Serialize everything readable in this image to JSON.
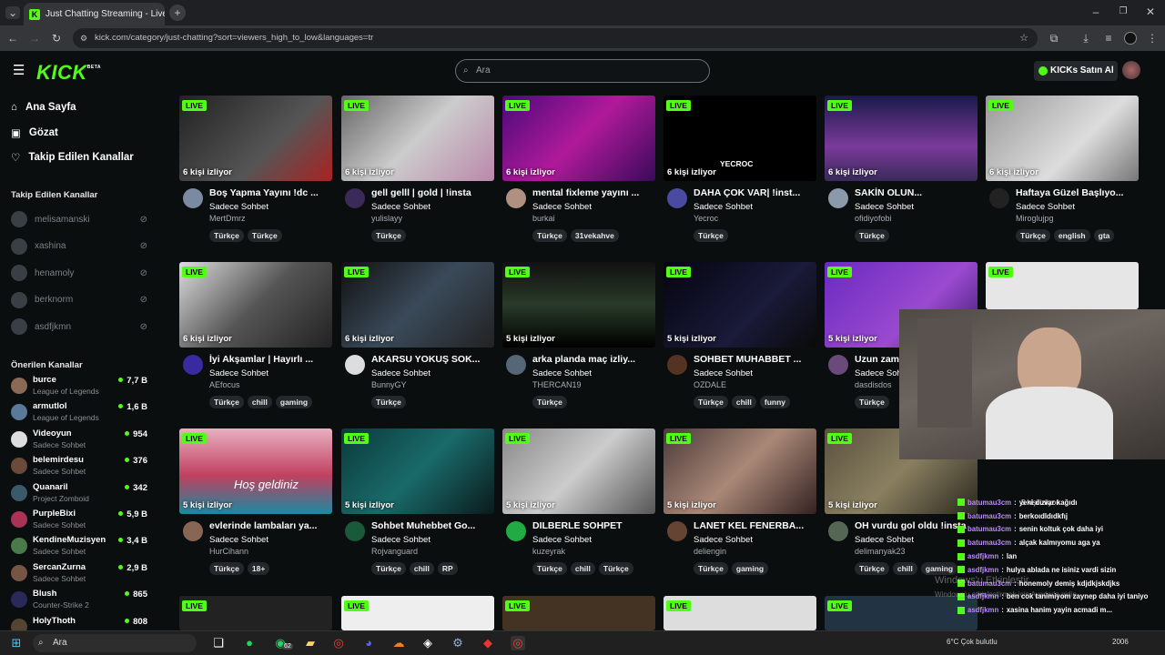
{
  "browser": {
    "tab_title": "Just Chatting Streaming - Live S",
    "url": "kick.com/category/just-chatting?sort=viewers_high_to_low&languages=tr"
  },
  "header": {
    "logo": "KICK",
    "logo_beta": "BETA",
    "search_placeholder": "Ara",
    "buy_kicks": "KICKs Satın Al"
  },
  "sidebar": {
    "nav": [
      {
        "label": "Ana Sayfa",
        "icon": "home-icon"
      },
      {
        "label": "Gözat",
        "icon": "browse-icon"
      },
      {
        "label": "Takip Edilen Kanallar",
        "icon": "heart-icon"
      }
    ],
    "followed_title": "Takip Edilen Kanallar",
    "followed": [
      "melisamanski",
      "xashina",
      "henamoly",
      "berknorm",
      "asdfjkmn"
    ],
    "recommended_title": "Önerilen Kanallar",
    "recommended": [
      {
        "name": "burce",
        "category": "League of Legends",
        "viewers": "7,7 B"
      },
      {
        "name": "armutlol",
        "category": "League of Legends",
        "viewers": "1,6 B"
      },
      {
        "name": "Videoyun",
        "category": "Sadece Sohbet",
        "viewers": "954"
      },
      {
        "name": "belemirdesu",
        "category": "Sadece Sohbet",
        "viewers": "376"
      },
      {
        "name": "Quanaril",
        "category": "Project Zomboid",
        "viewers": "342"
      },
      {
        "name": "PurpleBixi",
        "category": "Sadece Sohbet",
        "viewers": "5,9 B"
      },
      {
        "name": "KendineMuzisyen",
        "category": "Sadece Sohbet",
        "viewers": "3,4 B"
      },
      {
        "name": "SercanZurna",
        "category": "Sadece Sohbet",
        "viewers": "2,9 B"
      },
      {
        "name": "Blush",
        "category": "Counter-Strike 2",
        "viewers": "865"
      },
      {
        "name": "HolyThoth",
        "category": "",
        "viewers": "808"
      }
    ]
  },
  "live_label": "LIVE",
  "cards": [
    {
      "viewers": "6 kişi izliyor",
      "title": "Boş Yapma Yayını !dc ...",
      "category": "Sadece Sohbet",
      "user": "MertDmrz",
      "tags": [
        "Türkçe",
        "Türkçe"
      ]
    },
    {
      "viewers": "6 kişi izliyor",
      "title": "gell gelll | gold | !insta",
      "category": "Sadece Sohbet",
      "user": "yulislayy",
      "tags": [
        "Türkçe"
      ]
    },
    {
      "viewers": "6 kişi izliyor",
      "title": "mental fixleme yayını ...",
      "category": "Sadece Sohbet",
      "user": "burkai",
      "tags": [
        "Türkçe",
        "31vekahve"
      ]
    },
    {
      "viewers": "6 kişi izliyor",
      "title": "DAHA ÇOK VAR| !inst...",
      "category": "Sadece Sohbet",
      "user": "Yecroc",
      "tags": [
        "Türkçe"
      ],
      "thumb_text": "YECROC"
    },
    {
      "viewers": "6 kişi izliyor",
      "title": "SAKİN OLUN...",
      "category": "Sadece Sohbet",
      "user": "ofidiyofobi",
      "tags": [
        "Türkçe"
      ]
    },
    {
      "viewers": "6 kişi izliyor",
      "title": "Haftaya Güzel Başlıyo...",
      "category": "Sadece Sohbet",
      "user": "Miroglujpg",
      "tags": [
        "Türkçe",
        "english",
        "gta"
      ]
    },
    {
      "viewers": "6 kişi izliyor",
      "title": "İyi Akşamlar | Hayırlı ...",
      "category": "Sadece Sohbet",
      "user": "AEfocus",
      "tags": [
        "Türkçe",
        "chill",
        "gaming"
      ]
    },
    {
      "viewers": "6 kişi izliyor",
      "title": "AKARSU YOKUŞ SOK...",
      "category": "Sadece Sohbet",
      "user": "BunnyGY",
      "tags": [
        "Türkçe"
      ]
    },
    {
      "viewers": "5 kişi izliyor",
      "title": "arka planda maç izliy...",
      "category": "Sadece Sohbet",
      "user": "THERCAN19",
      "tags": [
        "Türkçe"
      ]
    },
    {
      "viewers": "5 kişi izliyor",
      "title": "SOHBET MUHABBET ...",
      "category": "Sadece Sohbet",
      "user": "OZDALE",
      "tags": [
        "Türkçe",
        "chill",
        "funny"
      ]
    },
    {
      "viewers": "5 kişi izliyor",
      "title": "Uzun zam",
      "category": "Sadece Soh",
      "user": "dasdisdos",
      "tags": [
        "Türkçe"
      ]
    },
    {
      "viewers": "",
      "title": "",
      "category": "",
      "user": "",
      "tags": []
    },
    {
      "viewers": "5 kişi izliyor",
      "title": "evlerinde lambaları ya...",
      "category": "Sadece Sohbet",
      "user": "HurCihann",
      "tags": [
        "Türkçe",
        "18+"
      ],
      "thumb_text": "Hoş geldiniz"
    },
    {
      "viewers": "5 kişi izliyor",
      "title": "Sohbet Muhebbet Go...",
      "category": "Sadece Sohbet",
      "user": "Rojvanguard",
      "tags": [
        "Türkçe",
        "chill",
        "RP"
      ]
    },
    {
      "viewers": "5 kişi izliyor",
      "title": "DILBERLE SOHPET",
      "category": "Sadece Sohbet",
      "user": "kuzeyrak",
      "tags": [
        "Türkçe",
        "chill",
        "Türkçe"
      ]
    },
    {
      "viewers": "5 kişi izliyor",
      "title": "LANET KEL FENERBA...",
      "category": "Sadece Sohbet",
      "user": "deliengin",
      "tags": [
        "Türkçe",
        "gaming"
      ]
    },
    {
      "viewers": "5 kişi izliyor",
      "title": "OH vurdu gol oldu !insta",
      "category": "Sadece Sohbet",
      "user": "delimanyak23",
      "tags": [
        "Türkçe",
        "chill",
        "gaming"
      ]
    }
  ],
  "overlay": {
    "chat": [
      {
        "user": "batumau3cm",
        "text": "yeni duvar kağıdı"
      },
      {
        "user": "batumau3cm",
        "text": "berkoıdldıdkfıj"
      },
      {
        "user": "batumau3cm",
        "text": "senin koltuk çok daha iyi"
      },
      {
        "user": "batumau3cm",
        "text": "alçak kalmıyomu aga ya"
      },
      {
        "user": "asdfjkmn",
        "text": "lan"
      },
      {
        "user": "asdfjkmn",
        "text": "hulya ablada ne isiniz vardi sizin"
      },
      {
        "user": "batumau3cm",
        "text": "honemoly demiş kdjdkjskdjks"
      },
      {
        "user": "asdfjkmn",
        "text": "ben cok tanimiyom zaynep daha iyi taniyo"
      },
      {
        "user": "asdfjkmn",
        "text": "xasina hanim yayin acmadi m..."
      }
    ],
    "watermark_line1": "Windows'u Etkinleştir",
    "watermark_line2": "Windows'u etkinleştirmek için Ayarlar'a gidin."
  },
  "taskbar": {
    "search": "Ara",
    "weather": "6°C Çok bulutlu",
    "time": "2006",
    "badge": "62"
  },
  "colors": {
    "accent": "#53fc18",
    "bg": "#0b0e0f",
    "tag_bg": "#24272c"
  }
}
